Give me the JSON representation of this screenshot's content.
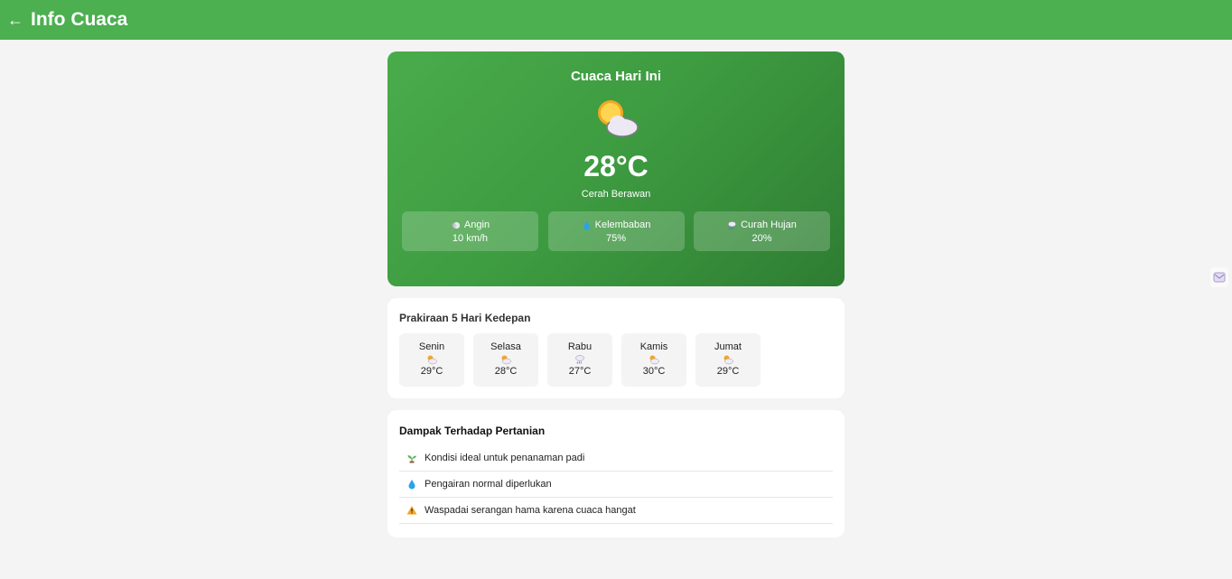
{
  "header": {
    "back_icon": "←",
    "title": "Info Cuaca"
  },
  "today": {
    "title": "Cuaca Hari Ini",
    "icon": "sun-behind-cloud-icon",
    "temperature": "28°C",
    "condition": "Cerah Berawan",
    "stats": [
      {
        "icon": "wind-icon",
        "label": "Angin",
        "value": "10 km/h"
      },
      {
        "icon": "droplet-icon",
        "label": "Kelembaban",
        "value": "75%"
      },
      {
        "icon": "rain-cloud-icon",
        "label": "Curah Hujan",
        "value": "20%"
      }
    ]
  },
  "forecast": {
    "title": "Prakiraan 5 Hari Kedepan",
    "days": [
      {
        "day": "Senin",
        "icon": "sun-behind-cloud-icon",
        "temp": "29°C"
      },
      {
        "day": "Selasa",
        "icon": "sun-behind-large-cloud-icon",
        "temp": "28°C"
      },
      {
        "day": "Rabu",
        "icon": "rain-cloud-icon",
        "temp": "27°C"
      },
      {
        "day": "Kamis",
        "icon": "sun-behind-cloud-icon",
        "temp": "30°C"
      },
      {
        "day": "Jumat",
        "icon": "sun-behind-large-cloud-icon",
        "temp": "29°C"
      }
    ]
  },
  "impact": {
    "title": "Dampak Terhadap Pertanian",
    "items": [
      {
        "icon": "seedling-icon",
        "text": "Kondisi ideal untuk penanaman padi"
      },
      {
        "icon": "droplet-icon",
        "text": "Pengairan normal diperlukan"
      },
      {
        "icon": "warning-icon",
        "text": "Waspadai serangan hama karena cuaca hangat"
      }
    ]
  },
  "colors": {
    "header": "#4caf50",
    "card_start": "#49ac4b",
    "card_end": "#2e7d32",
    "background": "#f4f4f4"
  }
}
